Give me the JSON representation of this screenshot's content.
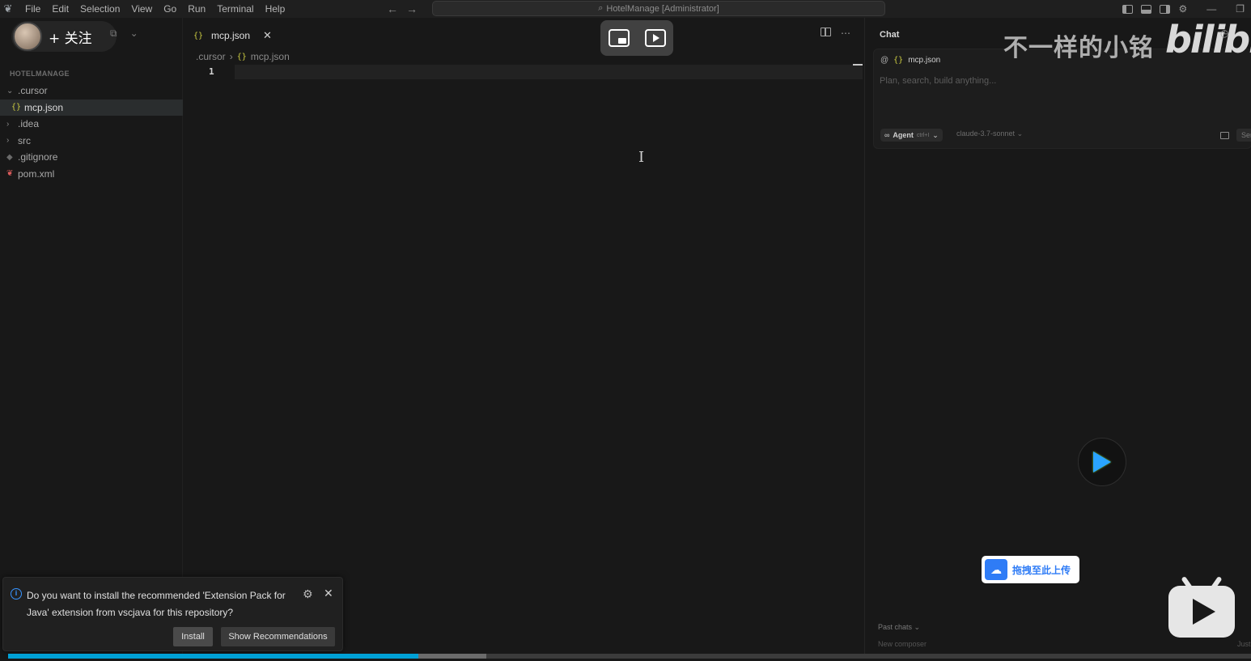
{
  "titlebar": {
    "menu": [
      "File",
      "Edit",
      "Selection",
      "View",
      "Go",
      "Run",
      "Terminal",
      "Help"
    ],
    "search_text": "HotelManage [Administrator]",
    "icons": [
      "back-arrow-icon",
      "forward-arrow-icon",
      "search-icon",
      "toggle-sidebar-icon",
      "toggle-panel-icon",
      "toggle-secondary-sidebar-icon",
      "settings-gear-icon",
      "minimize-icon",
      "restore-icon"
    ]
  },
  "overlay": {
    "follow_label": "+ 关注",
    "watermark": "不一样的小铭",
    "brand": "bilibili",
    "upload_label": "拖拽至此上传",
    "progress_played": 0.33,
    "progress_buffered": 0.385
  },
  "sidebar": {
    "project": "HOTELMANAGE",
    "tree": [
      {
        "label": ".cursor",
        "kind": "folder-open"
      },
      {
        "label": "mcp.json",
        "kind": "json",
        "selected": true
      },
      {
        "label": ".idea",
        "kind": "folder"
      },
      {
        "label": "src",
        "kind": "folder"
      },
      {
        "label": ".gitignore",
        "kind": "git"
      },
      {
        "label": "pom.xml",
        "kind": "maven"
      }
    ]
  },
  "editor": {
    "tab_label": "mcp.json",
    "tab_icon": "{}",
    "breadcrumb": [
      ".cursor",
      "mcp.json"
    ],
    "line_number": "1"
  },
  "chat": {
    "title": "Chat",
    "context_chip": "mcp.json",
    "placeholder": "Plan, search, build anything...",
    "agent_label": "Agent",
    "agent_shortcut": "ctrl+I",
    "model": "claude-3.7-sonnet",
    "send_label": "Send",
    "past_chats": "Past chats",
    "new_composer": "New composer",
    "just_label": "Just"
  },
  "notification": {
    "message": "Do you want to install the recommended 'Extension Pack for Java' extension from vscjava for this repository?",
    "install_label": "Install",
    "recommendations_label": "Show Recommendations"
  },
  "colors": {
    "accent_blue": "#3794ff",
    "json_icon": "#cbcb41",
    "progress": "#00a1d6"
  }
}
